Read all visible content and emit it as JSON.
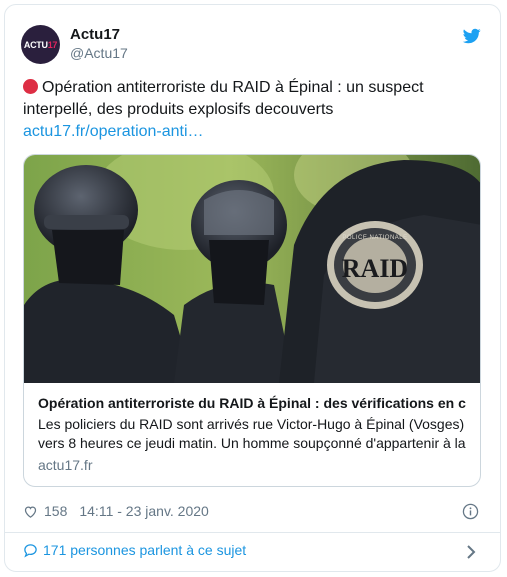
{
  "tweet": {
    "author_name": "Actu17",
    "author_handle": "@Actu17",
    "avatar_text_main": "ACTU",
    "avatar_text_num": "17",
    "text": "Opération antiterroriste du RAID à Épinal : un suspect interpellé, des produits explosifs decouverts",
    "link": "actu17.fr/operation-anti…",
    "likes": "158",
    "timestamp": "14:11 - 23 janv. 2020",
    "conversation": "171 personnes parlent à ce sujet"
  },
  "card": {
    "title": "Opération antiterroriste du RAID à Épinal : des vérifications en cours",
    "description": "Les policiers du RAID sont arrivés rue Victor-Hugo à Épinal (Vosges) vers 8 heures ce jeudi matin. Un homme soupçonné d'appartenir à la",
    "domain": "actu17.fr",
    "patch_top": "POLICE NATIONALE",
    "patch_main": "RAID"
  },
  "colors": {
    "accent": "#1b95e0",
    "twitter_blue": "#1da1f2",
    "alert_red": "#dd2e44",
    "secondary_text": "#657786"
  },
  "icons": [
    "twitter-bird-icon",
    "red-circle-emoji-icon",
    "heart-icon",
    "info-icon",
    "speech-bubble-icon",
    "chevron-right-icon"
  ]
}
